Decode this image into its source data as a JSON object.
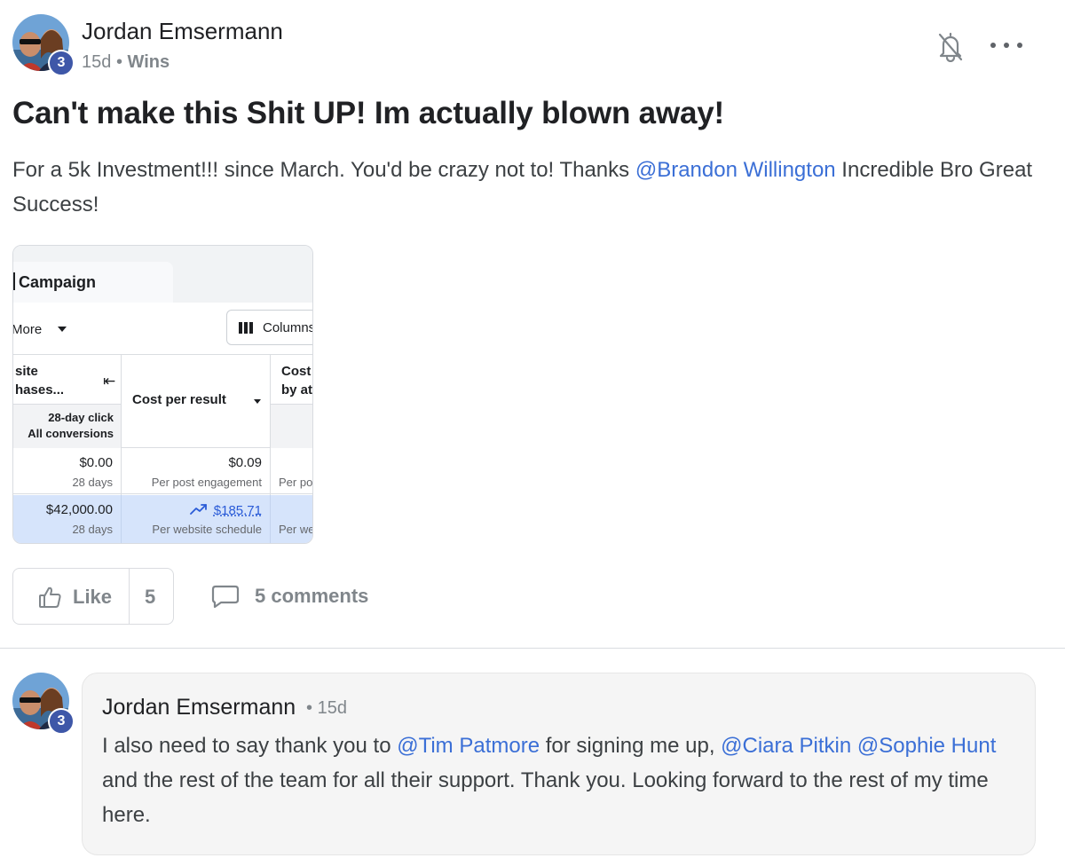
{
  "post": {
    "author": "Jordan Emsermann",
    "level": "3",
    "age": "15d",
    "separator": "•",
    "category": "Wins",
    "title": "Can't make this Shit UP! Im actually blown away!",
    "body_before": "For a 5k Investment!!! since March. You'd be crazy not to! Thanks ",
    "mention": "@Brandon Willington",
    "body_after": " Incredible Bro Great Success!"
  },
  "embedded": {
    "tab": "Campaign",
    "more": "More",
    "columns_button": "Columns",
    "col1_header_line1": "site",
    "col1_header_line2": "hases...",
    "col1_sub_line1": "28-day click",
    "col1_sub_line2": "All conversions",
    "col2_header": "Cost per result",
    "col3_header_line1": "Cost",
    "col3_header_line2": "by at",
    "row1": {
      "c1_value": "$0.00",
      "c1_sub": "28 days",
      "c2_value": "$0.09",
      "c2_sub": "Per post engagement",
      "c3_sub": "Per po"
    },
    "row2": {
      "c1_value": "$42,000.00",
      "c1_sub": "28 days",
      "c2_value": "$185.71",
      "c2_sub": "Per website schedule",
      "c3_sub": "Per we"
    }
  },
  "actions": {
    "like_label": "Like",
    "like_count": "5",
    "comments_label": "5 comments"
  },
  "comment": {
    "author": "Jordan Emsermann",
    "level": "3",
    "separator": "•",
    "age": "15d",
    "text_1": "I also need to say thank you to ",
    "mention_1": "@Tim Patmore",
    "text_2": " for signing me up, ",
    "mention_2": "@Ciara Pitkin",
    "text_3": " ",
    "mention_3": "@Sophie Hunt",
    "text_4": " and the rest of the team for all their support. Thank you. Looking forward to the rest of my time here."
  },
  "icons": {
    "notification": "bell-off-icon",
    "menu": "more-horizontal-icon",
    "like": "thumbs-up-icon",
    "comment": "comment-bubble-icon",
    "trend": "trending-up-icon",
    "collapse": "collapse-left-icon",
    "columns": "columns-icon"
  },
  "colors": {
    "mention": "#3b6fd6",
    "level_badge": "#3e57a8",
    "highlight_row": "#d6e4fb"
  }
}
